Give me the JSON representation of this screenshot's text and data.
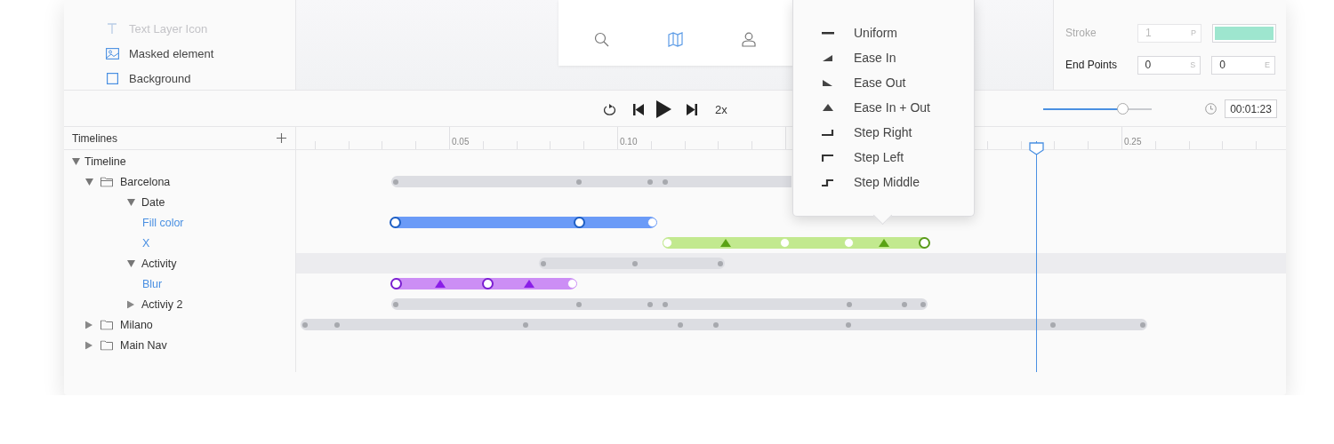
{
  "layers": [
    {
      "label": "Text Layer Icon",
      "kind": "text",
      "disabled": true
    },
    {
      "label": "Masked element",
      "kind": "image",
      "disabled": false
    },
    {
      "label": "Background",
      "kind": "rect",
      "disabled": false
    }
  ],
  "toolbar": {
    "tools": [
      {
        "kind": "search",
        "selected": false
      },
      {
        "kind": "map",
        "selected": true
      },
      {
        "kind": "user",
        "selected": false
      }
    ]
  },
  "properties": [
    {
      "label": "Stroke",
      "disabled": true,
      "fields": [
        {
          "kind": "input",
          "value": "1",
          "unit": "P"
        },
        {
          "kind": "swatch",
          "color": "#9ee6cf"
        }
      ]
    },
    {
      "label": "End Points",
      "disabled": false,
      "fields": [
        {
          "kind": "input",
          "value": "0",
          "unit": "S"
        },
        {
          "kind": "input",
          "value": "0",
          "unit": "E"
        }
      ]
    }
  ],
  "playback": {
    "speed": "2x",
    "zoom_slider": {
      "level": 0.73
    },
    "time": "00:01:23"
  },
  "timelines": {
    "title": "Timelines",
    "ruler": [
      "0.05",
      "0.10",
      "0.25"
    ],
    "tree": [
      {
        "label": "Timeline",
        "kind": "root",
        "expanded": true,
        "selected": false,
        "children": [
          {
            "label": "Barcelona",
            "kind": "folder",
            "expanded": true,
            "selected": false,
            "track": {
              "color": "#dcdde2",
              "keyframes": [
                {
                  "kind": "dot"
                },
                {
                  "kind": "dot"
                },
                {
                  "kind": "dot"
                },
                {
                  "kind": "dot"
                }
              ]
            },
            "children": [
              {
                "label": "Date",
                "kind": "group",
                "expanded": true,
                "selected": false,
                "children": [
                  {
                    "label": "Fill color",
                    "kind": "property",
                    "selected": false,
                    "track": {
                      "color": "#6b9bf7",
                      "keyframes": [
                        {
                          "kind": "ring"
                        },
                        {
                          "kind": "ring"
                        },
                        {
                          "kind": "open"
                        }
                      ]
                    }
                  },
                  {
                    "label": "X",
                    "kind": "property",
                    "selected": false,
                    "track": {
                      "color": "#c2e98f",
                      "keyframes": [
                        {
                          "kind": "open"
                        },
                        {
                          "kind": "triangle"
                        },
                        {
                          "kind": "open"
                        },
                        {
                          "kind": "open"
                        },
                        {
                          "kind": "triangle"
                        },
                        {
                          "kind": "ring"
                        }
                      ]
                    }
                  }
                ]
              },
              {
                "label": "Activity",
                "kind": "group",
                "expanded": true,
                "selected": true,
                "track": {
                  "color": "#dcdde2",
                  "keyframes": [
                    {
                      "kind": "dot"
                    },
                    {
                      "kind": "dot"
                    },
                    {
                      "kind": "dot"
                    }
                  ]
                },
                "children": [
                  {
                    "label": "Blur",
                    "kind": "property",
                    "selected": false,
                    "track": {
                      "color": "#cc8ef5",
                      "keyframes": [
                        {
                          "kind": "ring"
                        },
                        {
                          "kind": "triangle"
                        },
                        {
                          "kind": "ring"
                        },
                        {
                          "kind": "triangle"
                        },
                        {
                          "kind": "open"
                        }
                      ]
                    }
                  }
                ]
              },
              {
                "label": "Activiy 2",
                "kind": "group",
                "expanded": false,
                "selected": false,
                "track": {
                  "color": "#dcdde2",
                  "keyframes": [
                    {
                      "kind": "dot"
                    },
                    {
                      "kind": "dot"
                    },
                    {
                      "kind": "dot"
                    },
                    {
                      "kind": "dot"
                    },
                    {
                      "kind": "dot"
                    },
                    {
                      "kind": "dot"
                    },
                    {
                      "kind": "dot"
                    }
                  ]
                }
              }
            ]
          },
          {
            "label": "Milano",
            "kind": "folder",
            "expanded": false,
            "selected": false,
            "track": {
              "color": "#dcdde2",
              "keyframes": [
                {
                  "kind": "dot"
                },
                {
                  "kind": "dot"
                },
                {
                  "kind": "dot"
                },
                {
                  "kind": "dot"
                },
                {
                  "kind": "dot"
                },
                {
                  "kind": "dot"
                },
                {
                  "kind": "dot"
                },
                {
                  "kind": "dot"
                }
              ]
            }
          },
          {
            "label": "Main Nav",
            "kind": "folder",
            "expanded": false,
            "selected": false
          }
        ]
      }
    ]
  },
  "easing_menu": {
    "items": [
      {
        "label": "Uniform",
        "kind": "uniform"
      },
      {
        "label": "Ease In",
        "kind": "ease-in"
      },
      {
        "label": "Ease Out",
        "kind": "ease-out"
      },
      {
        "label": "Ease In + Out",
        "kind": "ease-in-out"
      },
      {
        "label": "Step Right",
        "kind": "step-right"
      },
      {
        "label": "Step Left",
        "kind": "step-left"
      },
      {
        "label": "Step Middle",
        "kind": "step-middle"
      }
    ]
  }
}
